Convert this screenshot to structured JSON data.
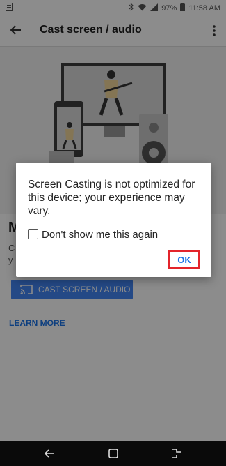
{
  "status": {
    "battery": "97%",
    "time": "11:58 AM"
  },
  "appbar": {
    "title": "Cast screen / audio"
  },
  "main": {
    "heading": "M",
    "body": "C",
    "body2": "y",
    "cast_button_label": "CAST SCREEN / AUDIO",
    "learn_more_label": "LEARN MORE"
  },
  "dialog": {
    "message": "Screen Casting is not optimized for this device; your experience may vary.",
    "checkbox_label": "Don't show me this again",
    "checkbox_checked": false,
    "ok_label": "OK",
    "highlight_color": "#e3242b"
  },
  "colors": {
    "accent": "#1a73e8",
    "button_bg": "#4285f4",
    "nav_bg": "#0a0a0a"
  },
  "icons": {
    "back": "arrow-left-icon",
    "more": "more-vert-icon",
    "cast": "cast-icon",
    "nav_back": "nav-back-icon",
    "nav_home": "nav-home-icon",
    "nav_recents": "nav-recents-icon"
  }
}
